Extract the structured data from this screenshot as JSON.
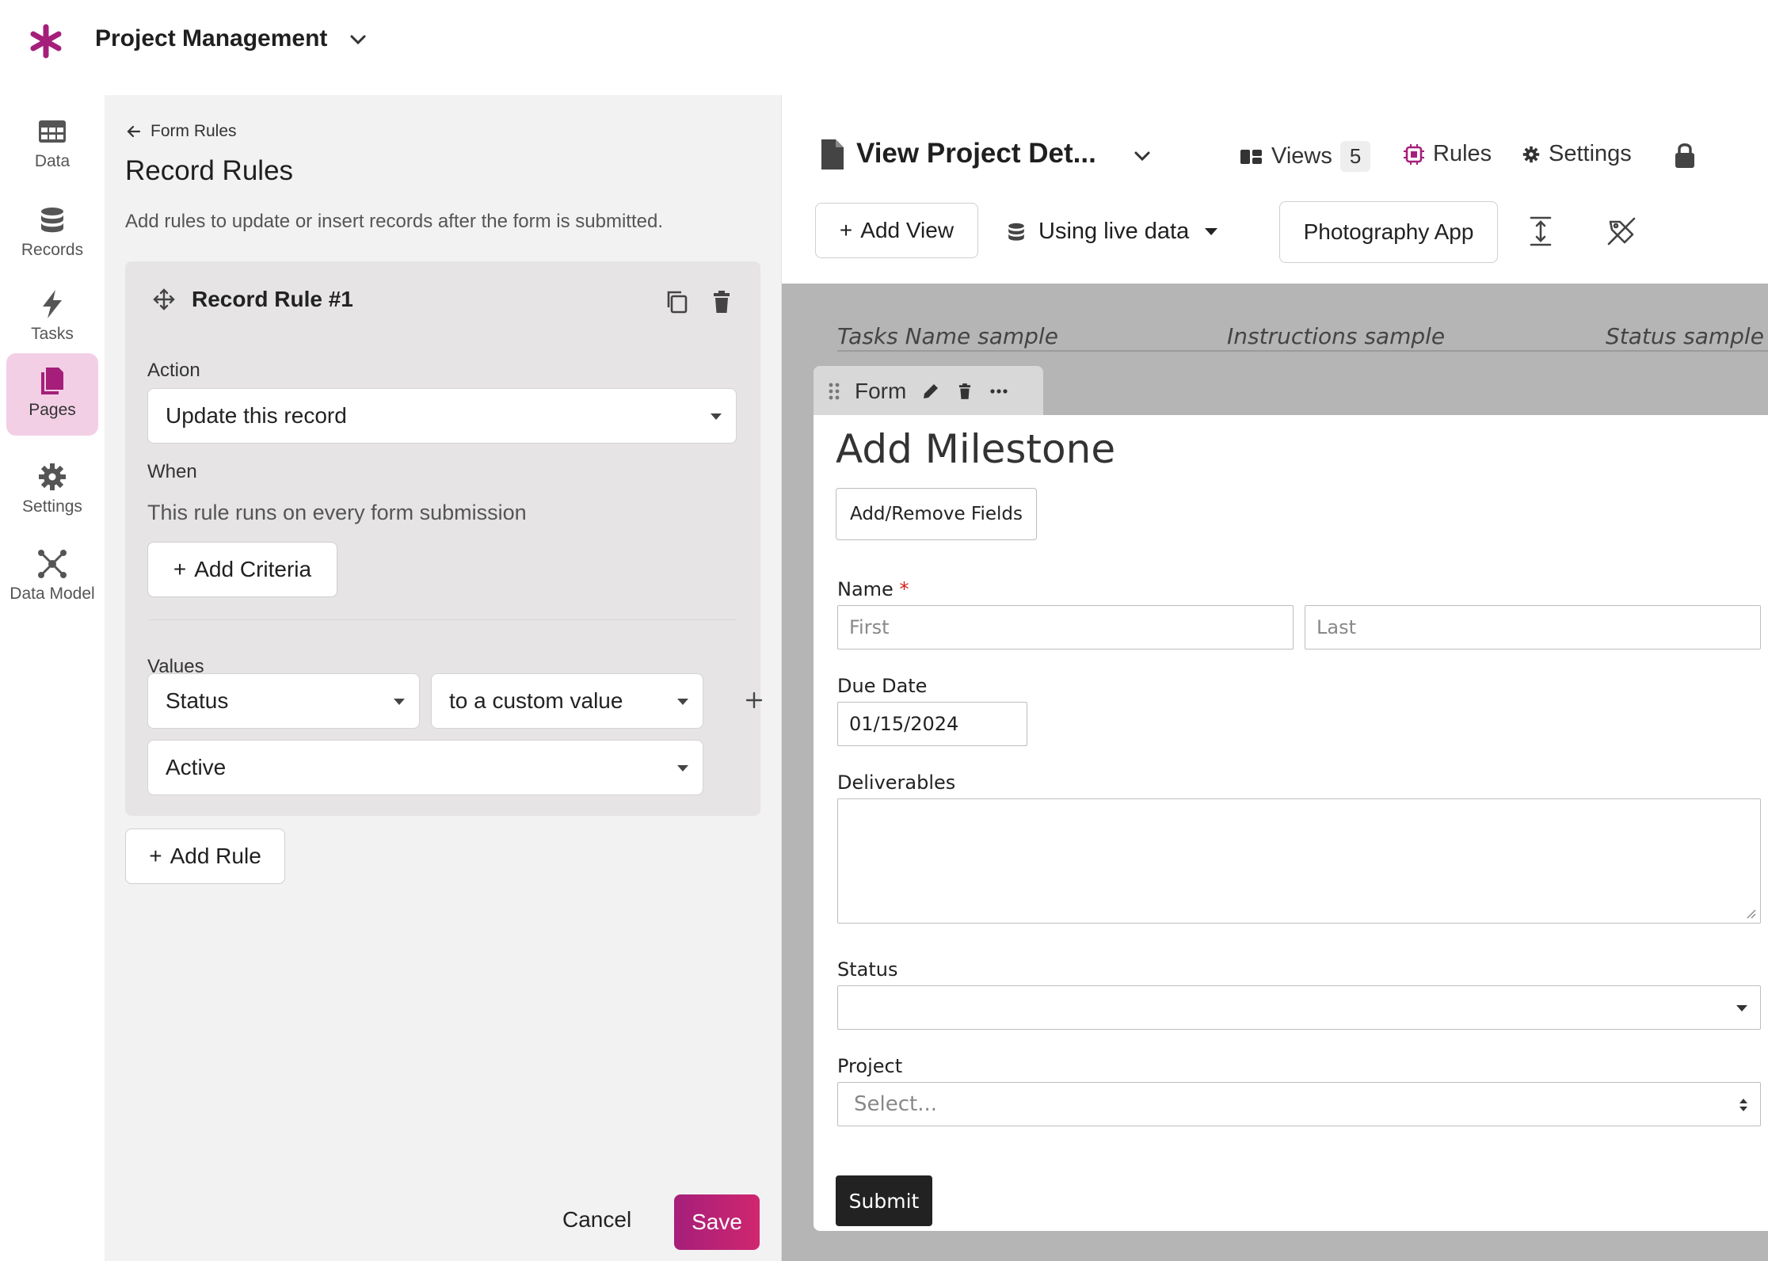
{
  "app": {
    "title": "Project Management"
  },
  "nav": {
    "items": [
      {
        "label": "Data",
        "icon": "table-icon"
      },
      {
        "label": "Records",
        "icon": "database-icon"
      },
      {
        "label": "Tasks",
        "icon": "bolt-icon"
      },
      {
        "label": "Pages",
        "icon": "pages-icon",
        "active": true
      },
      {
        "label": "Settings",
        "icon": "gear-icon"
      },
      {
        "label": "Data Model",
        "icon": "network-icon"
      }
    ]
  },
  "panel": {
    "breadcrumb": "Form Rules",
    "title": "Record Rules",
    "description": "Add rules to update or insert records after the form is submitted.",
    "rule": {
      "title": "Record Rule #1",
      "action_label": "Action",
      "action_value": "Update this record",
      "when_label": "When",
      "when_text": "This rule runs on every form submission",
      "add_criteria": "Add Criteria",
      "values_label": "Values",
      "field_value": "Status",
      "mode_value": "to a custom value",
      "custom_value": "Active"
    },
    "add_rule": "Add Rule",
    "cancel": "Cancel",
    "save": "Save"
  },
  "view": {
    "title": "View Project Det...",
    "views_label": "Views",
    "views_count": "5",
    "rules_label": "Rules",
    "settings_label": "Settings",
    "add_view": "Add View",
    "live_data": "Using live data",
    "app_button": "Photography App",
    "samples": [
      "Tasks Name sample",
      "Instructions sample",
      "Status sample"
    ]
  },
  "form": {
    "tab_label": "Form",
    "title": "Add Milestone",
    "add_remove": "Add/Remove Fields",
    "name_label": "Name",
    "required_mark": "*",
    "first_placeholder": "First",
    "last_placeholder": "Last",
    "due_label": "Due Date",
    "due_value": "01/15/2024",
    "deliverables_label": "Deliverables",
    "status_label": "Status",
    "project_label": "Project",
    "project_placeholder": "Select...",
    "submit": "Submit"
  },
  "colors": {
    "brand": "#a51f7a",
    "accent": "#d0266f",
    "active_nav_bg": "#f3cfe6"
  }
}
